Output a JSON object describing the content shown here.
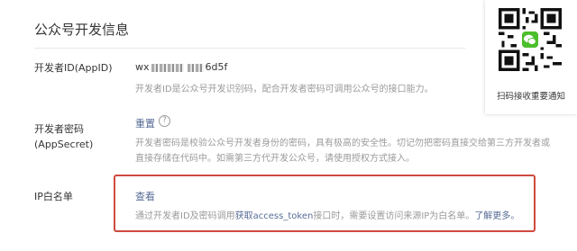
{
  "section": {
    "title": "公众号开发信息"
  },
  "rows": {
    "appid": {
      "label": "开发者ID(AppID)",
      "value_prefix": "wx",
      "value_suffix": "6d5f",
      "desc": "开发者ID是公众号开发识别码，配合开发者密码可调用公众号的接口能力。"
    },
    "secret": {
      "label_line1": "开发者密码",
      "label_line2": "(AppSecret)",
      "action": "重置",
      "help": "?",
      "desc_line1": "开发者密码是校验公众号开发者身份的密码，具有极高的安全性。切记勿把密码直接交给第三方开发者或",
      "desc_line2": "直接存储在代码中。如需第三方代开发公众号，请使用授权方式接入。"
    },
    "ip_whitelist": {
      "label": "IP白名单",
      "action": "查看",
      "desc_pre": "通过开发者ID及密码调用",
      "desc_link": "获取access_token",
      "desc_mid": "接口时，需要设置访问来源IP为白名单。",
      "desc_more": "了解更多。"
    }
  },
  "qr_panel": {
    "caption": "扫码接收重要通知",
    "icon": "wechat-logo"
  },
  "colors": {
    "link": "#576b95",
    "highlight": "#cf4a3e",
    "muted": "#9a9a9a",
    "text": "#353535"
  }
}
